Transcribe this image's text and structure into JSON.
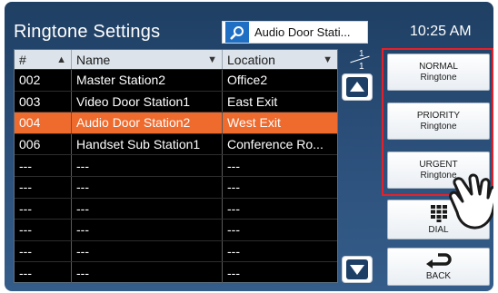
{
  "header": {
    "title": "Ringtone Settings",
    "search_value": "Audio Door Stati...",
    "clock": "10:25 AM"
  },
  "table": {
    "columns": [
      "#",
      "Name",
      "Location"
    ],
    "rows": [
      {
        "num": "002",
        "name": "Master Station2",
        "location": "Office2",
        "selected": false
      },
      {
        "num": "003",
        "name": "Video Door Station1",
        "location": "East Exit",
        "selected": false
      },
      {
        "num": "004",
        "name": "Audio Door Station2",
        "location": "West Exit",
        "selected": true
      },
      {
        "num": "006",
        "name": "Handset Sub Station1",
        "location": "Conference Ro...",
        "selected": false
      },
      {
        "num": "---",
        "name": "---",
        "location": "---",
        "selected": false
      },
      {
        "num": "---",
        "name": "---",
        "location": "---",
        "selected": false
      },
      {
        "num": "---",
        "name": "---",
        "location": "---",
        "selected": false
      },
      {
        "num": "---",
        "name": "---",
        "location": "---",
        "selected": false
      },
      {
        "num": "---",
        "name": "---",
        "location": "---",
        "selected": false
      },
      {
        "num": "---",
        "name": "---",
        "location": "---",
        "selected": false
      }
    ],
    "selected_color": "#ee6a2d"
  },
  "pagination": {
    "current": "1",
    "total": "1"
  },
  "buttons": {
    "normal": {
      "line1": "NORMAL",
      "line2": "Ringtone"
    },
    "priority": {
      "line1": "PRIORITY",
      "line2": "Ringtone"
    },
    "urgent": {
      "line1": "URGENT",
      "line2": "Ringtone"
    },
    "dial": "DIAL",
    "back": "BACK"
  },
  "colors": {
    "highlight_frame": "#e4212a",
    "search_icon_bg": "#1f6fc4"
  }
}
